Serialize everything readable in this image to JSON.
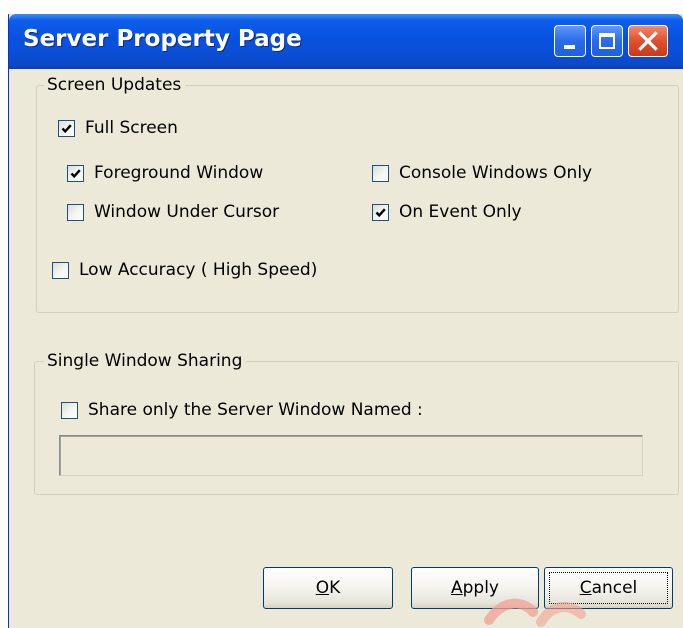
{
  "window": {
    "title": "Server Property Page"
  },
  "screen_updates": {
    "legend": "Screen Updates",
    "full_screen": {
      "label": "Full Screen",
      "checked": true
    },
    "foreground_window": {
      "label": "Foreground Window",
      "checked": true
    },
    "console_windows_only": {
      "label": "Console Windows Only",
      "checked": false
    },
    "window_under_cursor": {
      "label": "Window Under Cursor",
      "checked": false
    },
    "on_event_only": {
      "label": "On Event Only",
      "checked": true
    },
    "low_accuracy": {
      "label": "Low Accuracy ( High Speed)",
      "checked": false
    }
  },
  "single_window_sharing": {
    "legend": "Single Window Sharing",
    "share_only": {
      "label": "Share only the Server Window Named :",
      "checked": false
    },
    "window_name_value": ""
  },
  "buttons": {
    "ok": {
      "mnemonic": "O",
      "rest": "K"
    },
    "apply": {
      "mnemonic": "A",
      "rest": "pply"
    },
    "cancel": {
      "mnemonic": "C",
      "rest": "ancel"
    }
  },
  "colors": {
    "dialog_background": "#ECE9D8",
    "titlebar_blue": "#0851DF",
    "close_red": "#E0502D"
  }
}
